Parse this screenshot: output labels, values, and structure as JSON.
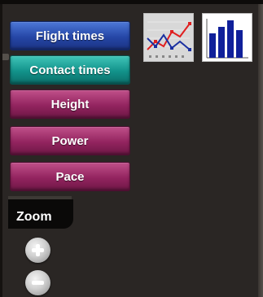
{
  "menu": {
    "items": [
      {
        "label": "Flight times"
      },
      {
        "label": "Contact times"
      },
      {
        "label": "Height"
      },
      {
        "label": "Power"
      },
      {
        "label": "Pace"
      }
    ]
  },
  "chart_types": {
    "line": {
      "icon": "line-chart-icon"
    },
    "bar": {
      "icon": "bar-chart-icon"
    }
  },
  "zoom": {
    "label": "Zoom",
    "in_icon": "zoom-in-icon",
    "out_icon": "zoom-out-icon"
  },
  "colors": {
    "flight_times": "#2546a6",
    "contact_times": "#12928a",
    "metric_buttons": "#93245f",
    "background": "#2a2624"
  }
}
